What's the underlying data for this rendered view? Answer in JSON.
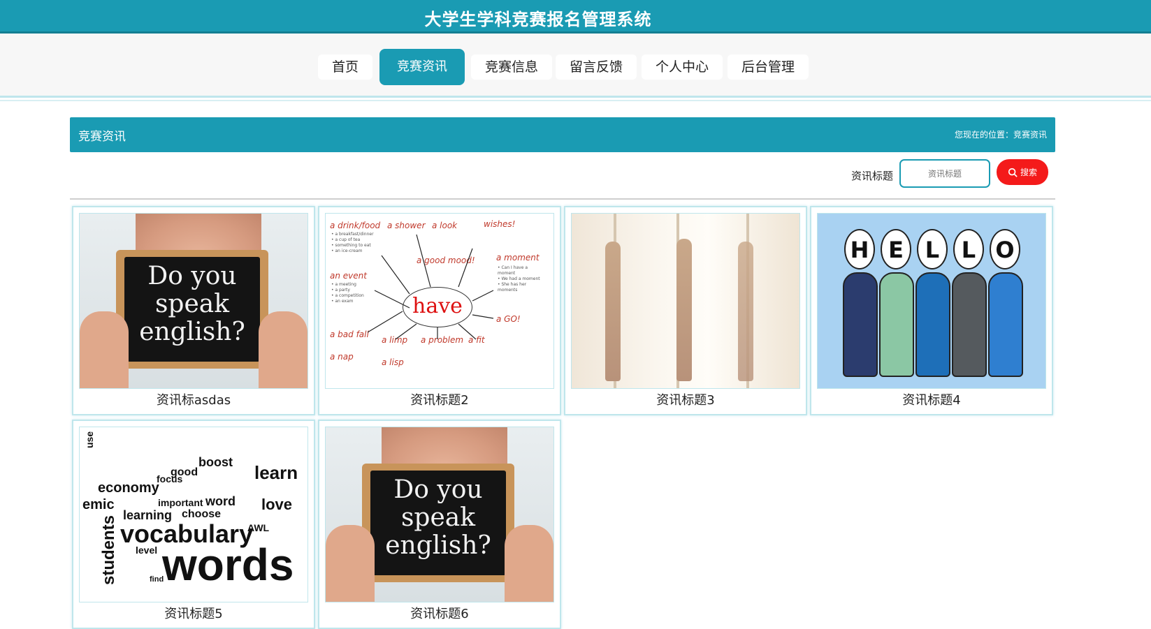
{
  "header": {
    "title": "大学生学科竞赛报名管理系统"
  },
  "nav": {
    "items": [
      {
        "label": "首页"
      },
      {
        "label": "竞赛资讯"
      },
      {
        "label": "竞赛信息"
      },
      {
        "label": "留言反馈"
      },
      {
        "label": "个人中心"
      },
      {
        "label": "后台管理"
      }
    ],
    "active": "竞赛资讯"
  },
  "section": {
    "title": "竞赛资讯",
    "breadcrumb": "您现在的位置：竞赛资讯"
  },
  "search": {
    "label": "资讯标题",
    "placeholder": "资讯标题",
    "button_label": "搜索"
  },
  "cards": [
    {
      "caption": "资讯标asdas",
      "image": "chalkboard-speak-english",
      "board_text": "Do you speak english?"
    },
    {
      "caption": "资讯标题2",
      "image": "have-mindmap",
      "center_word": "have"
    },
    {
      "caption": "资讯标题3",
      "image": "yoga-class"
    },
    {
      "caption": "资讯标题4",
      "image": "hello-kids",
      "letters": [
        "H",
        "E",
        "L",
        "L",
        "O"
      ]
    },
    {
      "caption": "资讯标题5",
      "image": "vocabulary-word-cloud"
    },
    {
      "caption": "资讯标题6",
      "image": "chalkboard-speak-english",
      "board_text": "Do you speak english?"
    }
  ],
  "colors": {
    "primary": "#1a9bb3",
    "search_button": "#f41a1a"
  }
}
